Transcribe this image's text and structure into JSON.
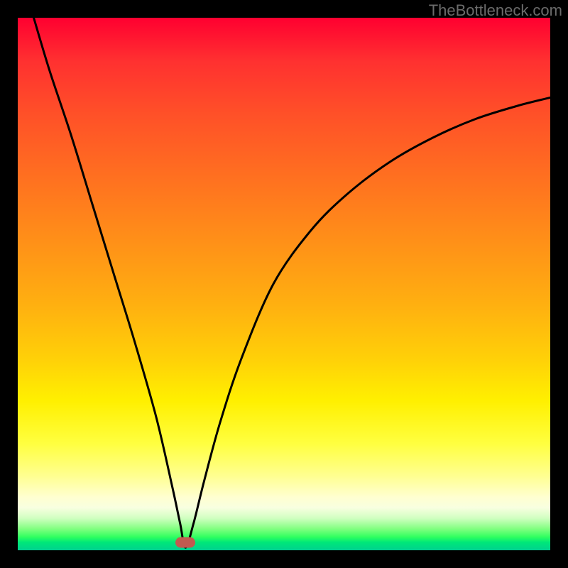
{
  "watermark": "TheBottleneck.com",
  "colors": {
    "background": "#000000",
    "gradient_top": "#ff0030",
    "gradient_bottom": "#00d090",
    "curve": "#000000",
    "marker": "#c25a50"
  },
  "chart_data": {
    "type": "line",
    "title": "",
    "xlabel": "",
    "ylabel": "",
    "xlim": [
      0,
      100
    ],
    "ylim": [
      0,
      100
    ],
    "marker": {
      "x": 31.5,
      "y": 1.5
    },
    "series": [
      {
        "name": "bottleneck-curve",
        "x": [
          3,
          6,
          10,
          14,
          18,
          22,
          26,
          29,
          30.5,
          31.5,
          33,
          35,
          38,
          42,
          48,
          55,
          62,
          70,
          78,
          86,
          94,
          100
        ],
        "y": [
          100,
          90,
          78,
          65,
          52,
          39,
          25,
          12,
          5,
          0.5,
          5,
          13,
          24,
          36,
          50,
          60,
          67,
          73,
          77.5,
          81,
          83.5,
          85
        ]
      }
    ]
  }
}
